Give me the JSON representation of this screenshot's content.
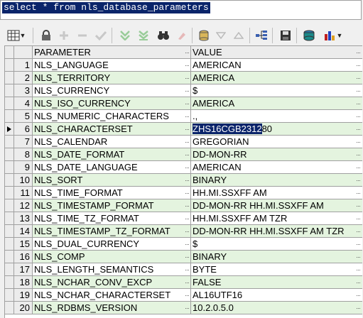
{
  "editor": {
    "sql": "select * from nls_database_parameters"
  },
  "grid": {
    "columns": [
      "PARAMETER",
      "VALUE"
    ],
    "current_row": 6,
    "rows": [
      {
        "num": "1",
        "param": "NLS_LANGUAGE",
        "value": "AMERICAN"
      },
      {
        "num": "2",
        "param": "NLS_TERRITORY",
        "value": "AMERICA"
      },
      {
        "num": "3",
        "param": "NLS_CURRENCY",
        "value": "$"
      },
      {
        "num": "4",
        "param": "NLS_ISO_CURRENCY",
        "value": "AMERICA"
      },
      {
        "num": "5",
        "param": "NLS_NUMERIC_CHARACTERS",
        "value": ".,"
      },
      {
        "num": "6",
        "param": "NLS_CHARACTERSET",
        "value": "ZHS16CGB231280",
        "selected_text": "ZHS16CGB2312",
        "rest_text": "80"
      },
      {
        "num": "7",
        "param": "NLS_CALENDAR",
        "value": "GREGORIAN"
      },
      {
        "num": "8",
        "param": "NLS_DATE_FORMAT",
        "value": "DD-MON-RR"
      },
      {
        "num": "9",
        "param": "NLS_DATE_LANGUAGE",
        "value": "AMERICAN"
      },
      {
        "num": "10",
        "param": "NLS_SORT",
        "value": "BINARY"
      },
      {
        "num": "11",
        "param": "NLS_TIME_FORMAT",
        "value": "HH.MI.SSXFF AM"
      },
      {
        "num": "12",
        "param": "NLS_TIMESTAMP_FORMAT",
        "value": "DD-MON-RR HH.MI.SSXFF AM"
      },
      {
        "num": "13",
        "param": "NLS_TIME_TZ_FORMAT",
        "value": "HH.MI.SSXFF AM TZR"
      },
      {
        "num": "14",
        "param": "NLS_TIMESTAMP_TZ_FORMAT",
        "value": "DD-MON-RR HH.MI.SSXFF AM TZR"
      },
      {
        "num": "15",
        "param": "NLS_DUAL_CURRENCY",
        "value": "$"
      },
      {
        "num": "16",
        "param": "NLS_COMP",
        "value": "BINARY"
      },
      {
        "num": "17",
        "param": "NLS_LENGTH_SEMANTICS",
        "value": "BYTE"
      },
      {
        "num": "18",
        "param": "NLS_NCHAR_CONV_EXCP",
        "value": "FALSE"
      },
      {
        "num": "19",
        "param": "NLS_NCHAR_CHARACTERSET",
        "value": "AL16UTF16"
      },
      {
        "num": "20",
        "param": "NLS_RDBMS_VERSION",
        "value": "10.2.0.5.0"
      }
    ]
  },
  "colors": {
    "row_alt": "#e4f4df",
    "selection": "#0a246a",
    "header": "#ececec"
  },
  "toolbar_icons": [
    "grid-menu-icon",
    "lock-icon",
    "add-row-icon",
    "delete-row-icon",
    "post-icon",
    "fetch-next-icon",
    "fetch-last-icon",
    "find-icon",
    "clear-icon",
    "query-by-example-icon",
    "filter-icon",
    "sort-icon",
    "tree-icon",
    "save-icon",
    "export-icon",
    "chart-icon"
  ]
}
